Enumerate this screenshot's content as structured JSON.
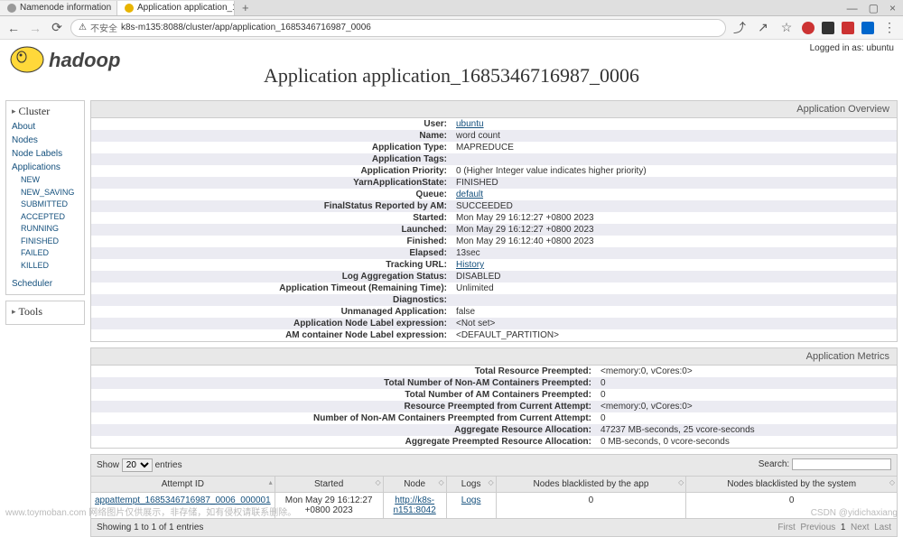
{
  "browser": {
    "tabs": [
      {
        "title": "Namenode information"
      },
      {
        "title": "Application application_16..."
      }
    ],
    "url_warning": "不安全",
    "url": "k8s-m135:8088/cluster/app/application_1685346716987_0006"
  },
  "logged_in": "Logged in as: ubuntu",
  "page_title": "Application application_1685346716987_0006",
  "sidebar": {
    "cluster_head": "Cluster",
    "cluster_links": [
      "About",
      "Nodes",
      "Node Labels",
      "Applications"
    ],
    "app_states": [
      "NEW",
      "NEW_SAVING",
      "SUBMITTED",
      "ACCEPTED",
      "RUNNING",
      "FINISHED",
      "FAILED",
      "KILLED"
    ],
    "scheduler": "Scheduler",
    "tools_head": "Tools"
  },
  "overview": {
    "heading": "Application Overview",
    "rows": [
      {
        "label": "User:",
        "value": "ubuntu",
        "link": true
      },
      {
        "label": "Name:",
        "value": "word count"
      },
      {
        "label": "Application Type:",
        "value": "MAPREDUCE"
      },
      {
        "label": "Application Tags:",
        "value": ""
      },
      {
        "label": "Application Priority:",
        "value": "0 (Higher Integer value indicates higher priority)"
      },
      {
        "label": "YarnApplicationState:",
        "value": "FINISHED"
      },
      {
        "label": "Queue:",
        "value": "default",
        "link": true
      },
      {
        "label": "FinalStatus Reported by AM:",
        "value": "SUCCEEDED"
      },
      {
        "label": "Started:",
        "value": "Mon May 29 16:12:27 +0800 2023"
      },
      {
        "label": "Launched:",
        "value": "Mon May 29 16:12:27 +0800 2023"
      },
      {
        "label": "Finished:",
        "value": "Mon May 29 16:12:40 +0800 2023"
      },
      {
        "label": "Elapsed:",
        "value": "13sec"
      },
      {
        "label": "Tracking URL:",
        "value": "History",
        "link": true
      },
      {
        "label": "Log Aggregation Status:",
        "value": "DISABLED"
      },
      {
        "label": "Application Timeout (Remaining Time):",
        "value": "Unlimited"
      },
      {
        "label": "Diagnostics:",
        "value": ""
      },
      {
        "label": "Unmanaged Application:",
        "value": "false"
      },
      {
        "label": "Application Node Label expression:",
        "value": "<Not set>"
      },
      {
        "label": "AM container Node Label expression:",
        "value": "<DEFAULT_PARTITION>"
      }
    ]
  },
  "metrics": {
    "heading": "Application Metrics",
    "rows": [
      {
        "label": "Total Resource Preempted:",
        "value": "<memory:0, vCores:0>"
      },
      {
        "label": "Total Number of Non-AM Containers Preempted:",
        "value": "0"
      },
      {
        "label": "Total Number of AM Containers Preempted:",
        "value": "0"
      },
      {
        "label": "Resource Preempted from Current Attempt:",
        "value": "<memory:0, vCores:0>"
      },
      {
        "label": "Number of Non-AM Containers Preempted from Current Attempt:",
        "value": "0"
      },
      {
        "label": "Aggregate Resource Allocation:",
        "value": "47237 MB-seconds, 25 vcore-seconds"
      },
      {
        "label": "Aggregate Preempted Resource Allocation:",
        "value": "0 MB-seconds, 0 vcore-seconds"
      }
    ]
  },
  "attempts_table": {
    "show_label_pre": "Show",
    "show_value": "20",
    "show_label_post": "entries",
    "search_label": "Search:",
    "headers": [
      "Attempt ID",
      "Started",
      "Node",
      "Logs",
      "Nodes blacklisted by the app",
      "Nodes blacklisted by the system"
    ],
    "row": {
      "attempt_id": "appattempt_1685346716987_0006_000001",
      "started": "Mon May 29 16:12:27 +0800 2023",
      "node": "http://k8s-n151:8042",
      "logs": "Logs",
      "bl_app": "0",
      "bl_sys": "0"
    },
    "info": "Showing 1 to 1 of 1 entries",
    "pager": {
      "first": "First",
      "prev": "Previous",
      "page": "1",
      "next": "Next",
      "last": "Last"
    }
  },
  "watermark_left": "www.toymoban.com  网络图片仅供展示，非存储，如有侵权请联系删除。",
  "watermark_right": "CSDN @yidichaxiang"
}
